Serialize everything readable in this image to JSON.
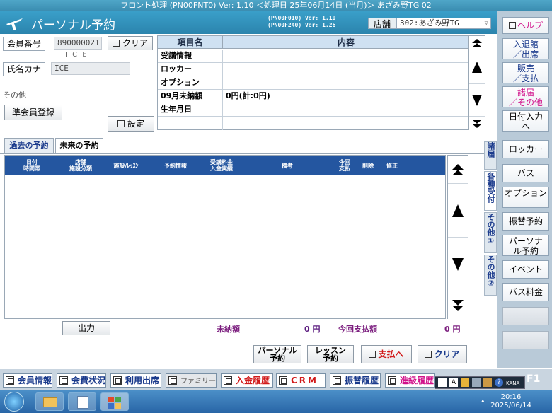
{
  "window_title": "フロント処理 (PN00FNT0) Ver: 1.10 ＜処理日 25年06月14日 (当月)＞ あざみ野TG 02",
  "header": {
    "app_title": "パーソナル予約",
    "prog_version_1": "(PN00F010)  Ver: 1.10",
    "prog_version_2": "(PN00F240)  Ver: 1.26",
    "store_label": "店舗",
    "store_value": "302:あざみ野TG"
  },
  "member": {
    "member_no_label": "会員番号",
    "member_no_value": "890000021",
    "clear_label": "クリア",
    "name_roman": "I C E",
    "kana_label": "氏名カナ",
    "kana_value": "ICE",
    "other_label": "その他",
    "associate_btn": "準会員登録",
    "settings_btn": "設定"
  },
  "info_table": {
    "col_item": "項目名",
    "col_content": "内容",
    "rows": [
      {
        "key": "受講情報",
        "value": ""
      },
      {
        "key": "ロッカー",
        "value": ""
      },
      {
        "key": "オプション",
        "value": ""
      },
      {
        "key": "09月未納額",
        "value": "0円(計:0円)"
      },
      {
        "key": "生年月日",
        "value": ""
      }
    ]
  },
  "tabs": {
    "past": "過去の予約",
    "future": "未来の予約"
  },
  "reservation_columns": [
    "日付\n時間帯",
    "店舗\n施設分類",
    "施設/ﾚｯｽﾝ",
    "予約情報",
    "受講料金\n入金実績",
    "備考",
    "今回\n支払",
    "削除",
    "修正"
  ],
  "summary": {
    "output_btn": "出力",
    "unpaid_label": "未納額",
    "unpaid_value": "0 円",
    "pay_label": "今回支払額",
    "pay_value": "0 円"
  },
  "bottom_buttons": {
    "personal": "パーソナル\n予約",
    "lesson": "レッスン\n予約",
    "pay": "支払へ",
    "clear": "クリア"
  },
  "right_panel": {
    "help": "ヘルプ",
    "checkin": "入退館\n／出席",
    "sales": "販売\n／支払",
    "misc": "諸届\n／その他",
    "date_input": "日付入力\nへ",
    "locker": "ロッカー",
    "bus": "バス",
    "option": "オプション",
    "transfer": "振替予約",
    "personal": "パーソナ\nル予約",
    "event": "イベント",
    "bus_fee": "バス料金"
  },
  "vertical_tabs": [
    {
      "label": "諸届"
    },
    {
      "label": "各種受付"
    },
    {
      "label": "その他①"
    },
    {
      "label": "その他②"
    }
  ],
  "nav_bar": [
    {
      "label": "会員情報"
    },
    {
      "label": "会費状況"
    },
    {
      "label": "利用出席"
    },
    {
      "label": "ファミリー"
    },
    {
      "label": "入金履歴"
    },
    {
      "label": "CRM"
    },
    {
      "label": "振替履歴"
    },
    {
      "label": "進級履歴"
    }
  ],
  "taskbar": {
    "time": "20:16",
    "date": "2025/06/14",
    "f1": "F1",
    "kana": "KANA"
  },
  "colors": {
    "header_blue": "#2b84ad",
    "table_header_blue": "#2456a0",
    "pink_accent": "#d1118a",
    "purple_text": "#7b1d7e",
    "red_text": "#d11a1a"
  }
}
